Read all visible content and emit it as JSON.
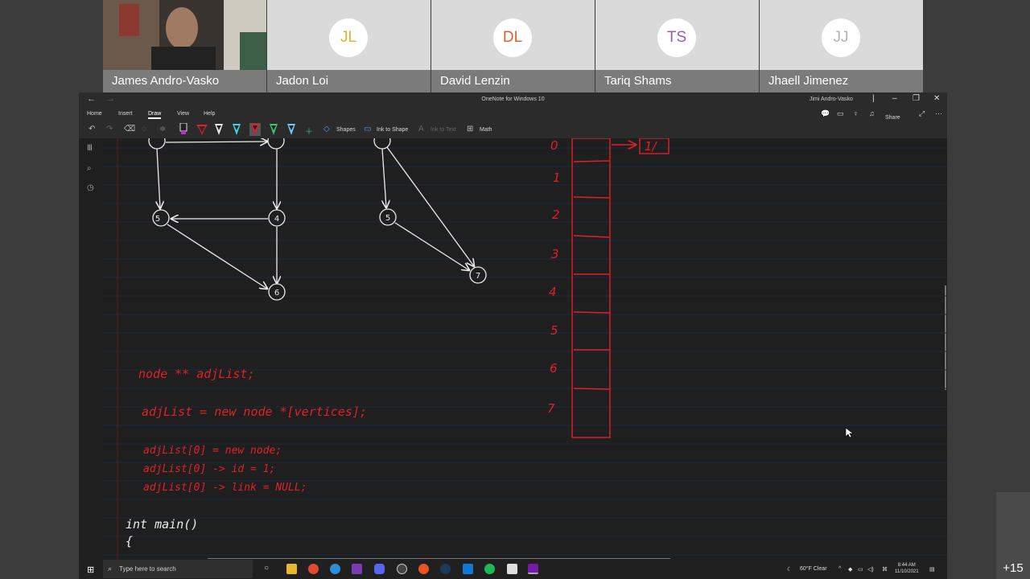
{
  "participants": [
    {
      "name": "James Andro-Vasko",
      "initials": "",
      "video": true
    },
    {
      "name": "Jadon Loi",
      "initials": "JL",
      "color": "#e3b02a"
    },
    {
      "name": "David Lenzin",
      "initials": "DL",
      "color": "#e0612e"
    },
    {
      "name": "Tariq Shams",
      "initials": "TS",
      "color": "#a259b5"
    },
    {
      "name": "Jhaell Jimenez",
      "initials": "JJ",
      "color": "#b5b5b5"
    }
  ],
  "extra_participants": "+15",
  "window": {
    "title": "OneNote for Windows 10",
    "user": "Jimi Andro-Vasko",
    "share_label": "Share"
  },
  "menu": [
    "Home",
    "Insert",
    "Draw",
    "View",
    "Help"
  ],
  "active_menu": "Draw",
  "ribbon": {
    "shapes": "Shapes",
    "ink_to_shape": "Ink to Shape",
    "ink_to_text": "Ink to Text",
    "math": "Math"
  },
  "ink": {
    "graph_nodes": [
      "5",
      "4",
      "6",
      "7"
    ],
    "array_indices": [
      "0",
      "1",
      "2",
      "3",
      "4",
      "5",
      "6",
      "7"
    ],
    "array_entry": "1/",
    "code_lines": [
      "node ** adjList;",
      "adjList = new node *[vertices];",
      "adjList[0] = new node;",
      "adjList[0] -> id = 1;",
      "adjList[0] -> link = NULL;"
    ],
    "main_lines": [
      "int   main()",
      "{"
    ]
  },
  "taskbar": {
    "search_placeholder": "Type here to search",
    "weather": "60°F  Clear",
    "time": "8:44 AM",
    "date": "11/10/2021"
  },
  "colors": {
    "ink_red": "#e0202a",
    "ink_white": "#ececec",
    "canvas_bg": "#1f1f1f",
    "rule_line": "#1e2a3e",
    "margin_line": "#5a1c1c"
  }
}
